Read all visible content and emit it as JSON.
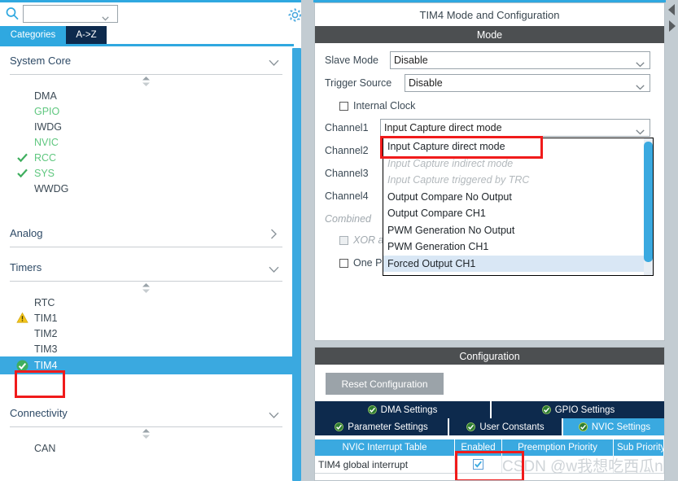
{
  "left_panel": {
    "search": {
      "value": "",
      "placeholder": ""
    },
    "search_icon": "search-icon",
    "gear_icon": "gear-icon",
    "tabs": [
      {
        "label": "Categories",
        "active": true
      },
      {
        "label": "A->Z",
        "active": false
      }
    ],
    "groups": [
      {
        "name": "System Core",
        "expanded": true,
        "items": [
          {
            "label": "DMA",
            "state": "none",
            "color": "#3c4a55"
          },
          {
            "label": "GPIO",
            "state": "none",
            "color": "#5fc77f"
          },
          {
            "label": "IWDG",
            "state": "none",
            "color": "#3c4a55"
          },
          {
            "label": "NVIC",
            "state": "none",
            "color": "#5fc77f"
          },
          {
            "label": "RCC",
            "state": "check",
            "color": "#5fc77f"
          },
          {
            "label": "SYS",
            "state": "check",
            "color": "#5fc77f"
          },
          {
            "label": "WWDG",
            "state": "none",
            "color": "#3c4a55"
          }
        ]
      },
      {
        "name": "Analog",
        "expanded": false,
        "items": []
      },
      {
        "name": "Timers",
        "expanded": true,
        "items": [
          {
            "label": "RTC",
            "state": "none",
            "color": "#3c4a55"
          },
          {
            "label": "TIM1",
            "state": "warning",
            "color": "#3c4a55"
          },
          {
            "label": "TIM2",
            "state": "none",
            "color": "#3c4a55"
          },
          {
            "label": "TIM3",
            "state": "none",
            "color": "#3c4a55"
          },
          {
            "label": "TIM4",
            "state": "ok",
            "color": "#ffffff",
            "selected": true
          }
        ]
      },
      {
        "name": "Connectivity",
        "expanded": true,
        "items": [
          {
            "label": "CAN",
            "state": "none",
            "color": "#3c4a55"
          }
        ]
      }
    ]
  },
  "right_panel": {
    "title": "TIM4 Mode and Configuration",
    "mode_band": "Mode",
    "fields": [
      {
        "label": "Slave Mode",
        "value": "Disable"
      },
      {
        "label": "Trigger Source",
        "value": "Disable"
      }
    ],
    "internal_clock": {
      "label": "Internal Clock",
      "checked": false
    },
    "channels": [
      {
        "label": "Channel1",
        "value": "Input Capture direct mode"
      },
      {
        "label": "Channel2",
        "value": ""
      },
      {
        "label": "Channel3",
        "value": ""
      },
      {
        "label": "Channel4",
        "value": ""
      }
    ],
    "combined_label": "Combined",
    "xor_label": "XOR a",
    "one_pulse_label": "One P",
    "dropdown": {
      "open": true,
      "options": [
        {
          "label": "Input Capture direct mode",
          "disabled": false,
          "highlight": false
        },
        {
          "label": "Input Capture indirect mode",
          "disabled": true,
          "highlight": false
        },
        {
          "label": "Input Capture triggered by TRC",
          "disabled": true,
          "highlight": false
        },
        {
          "label": "Output Compare No Output",
          "disabled": false,
          "highlight": false
        },
        {
          "label": "Output Compare CH1",
          "disabled": false,
          "highlight": false
        },
        {
          "label": "PWM Generation No Output",
          "disabled": false,
          "highlight": false
        },
        {
          "label": "PWM Generation CH1",
          "disabled": false,
          "highlight": false
        },
        {
          "label": "Forced Output CH1",
          "disabled": false,
          "highlight": true
        }
      ]
    }
  },
  "configuration": {
    "band": "Configuration",
    "reset_button": "Reset Configuration",
    "tabs_row1": [
      {
        "label": "DMA Settings",
        "active": false
      },
      {
        "label": "GPIO Settings",
        "active": false
      }
    ],
    "tabs_row2": [
      {
        "label": "Parameter Settings",
        "active": false
      },
      {
        "label": "User Constants",
        "active": false
      },
      {
        "label": "NVIC Settings",
        "active": true
      }
    ],
    "nvic_table": {
      "columns": [
        "NVIC Interrupt Table",
        "Enabled",
        "Preemption Priority",
        "Sub Priority"
      ],
      "rows": [
        {
          "name": "TIM4 global interrupt",
          "enabled": true,
          "preemption": "",
          "sub": ""
        }
      ]
    }
  },
  "watermark": "CSDN @w我想吃西瓜n",
  "colors": {
    "accent_blue": "#2fa8e0",
    "list_blue": "#3aa9e0",
    "dark_navy": "#0d2a4d",
    "band_gray": "#4c4f51",
    "red_highlight": "#f01b1b",
    "green": "#5fc77f",
    "warning_yellow": "#f5c518"
  }
}
